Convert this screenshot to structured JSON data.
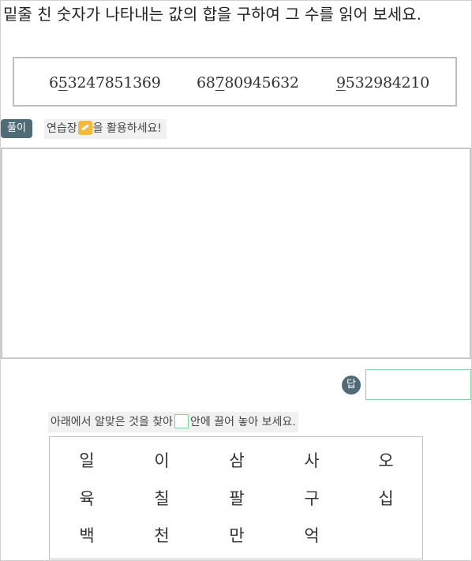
{
  "question": "밑줄 친 숫자가 나타내는 값의 합을 구하여 그 수를 읽어 보세요.",
  "numbers": [
    {
      "pre": "6",
      "ul": "5",
      "post": "3247851369"
    },
    {
      "pre": "68",
      "ul": "7",
      "post": "80945632"
    },
    {
      "pre": "",
      "ul": "9",
      "post": "532984210"
    }
  ],
  "solution_badge": "풀이",
  "hint": {
    "before": "연습장",
    "after": "을 활용하세요!"
  },
  "answer_badge": "답",
  "instruction": {
    "before": "아래에서 알맞은 것을 찾아",
    "after": "안에 끌어 놓아 보세요."
  },
  "cards": [
    "일",
    "이",
    "삼",
    "사",
    "오",
    "육",
    "칠",
    "팔",
    "구",
    "십",
    "백",
    "천",
    "만",
    "억"
  ]
}
